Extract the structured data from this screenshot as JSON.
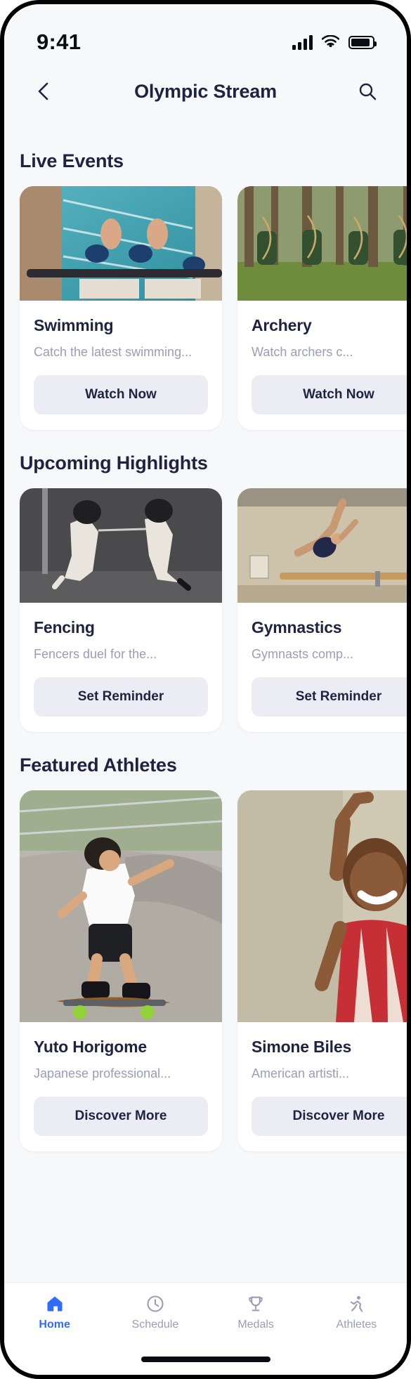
{
  "status_bar": {
    "time": "9:41",
    "icons": [
      "signal-icon",
      "wifi-icon",
      "battery-icon"
    ]
  },
  "header": {
    "back_icon": "chevron-left-icon",
    "title": "Olympic Stream",
    "search_icon": "search-icon"
  },
  "sections": [
    {
      "title": "Live Events",
      "cards": [
        {
          "title": "Swimming",
          "description": "Catch the latest swimming...",
          "button": "Watch Now",
          "image": "swimming-pool-race-photo"
        },
        {
          "title": "Archery",
          "description": "Watch archers c...",
          "button": "Watch Now",
          "image": "archery-forest-photo"
        }
      ]
    },
    {
      "title": "Upcoming Highlights",
      "cards": [
        {
          "title": "Fencing",
          "description": "Fencers duel for the...",
          "button": "Set Reminder",
          "image": "fencing-duel-photo"
        },
        {
          "title": "Gymnastics",
          "description": "Gymnasts comp...",
          "button": "Set Reminder",
          "image": "gymnastics-bar-photo"
        }
      ]
    },
    {
      "title": "Featured Athletes",
      "cards": [
        {
          "title": "Yuto Horigome",
          "description": "Japanese professional...",
          "button": "Discover More",
          "image": "skateboarder-park-photo"
        },
        {
          "title": "Simone Biles",
          "description": "American artisti...",
          "button": "Discover More",
          "image": "gymnast-celebrating-photo"
        }
      ]
    }
  ],
  "tab_bar": {
    "items": [
      {
        "label": "Home",
        "icon": "home-icon",
        "active": true
      },
      {
        "label": "Schedule",
        "icon": "clock-icon",
        "active": false
      },
      {
        "label": "Medals",
        "icon": "trophy-icon",
        "active": false
      },
      {
        "label": "Athletes",
        "icon": "athlete-icon",
        "active": false
      }
    ]
  },
  "colors": {
    "accent": "#2f6bff",
    "title": "#1e2342",
    "muted": "#9a9db8",
    "button_bg": "#ecedf4",
    "page_bg": "#f7f8fa",
    "card_bg": "#ffffff"
  }
}
